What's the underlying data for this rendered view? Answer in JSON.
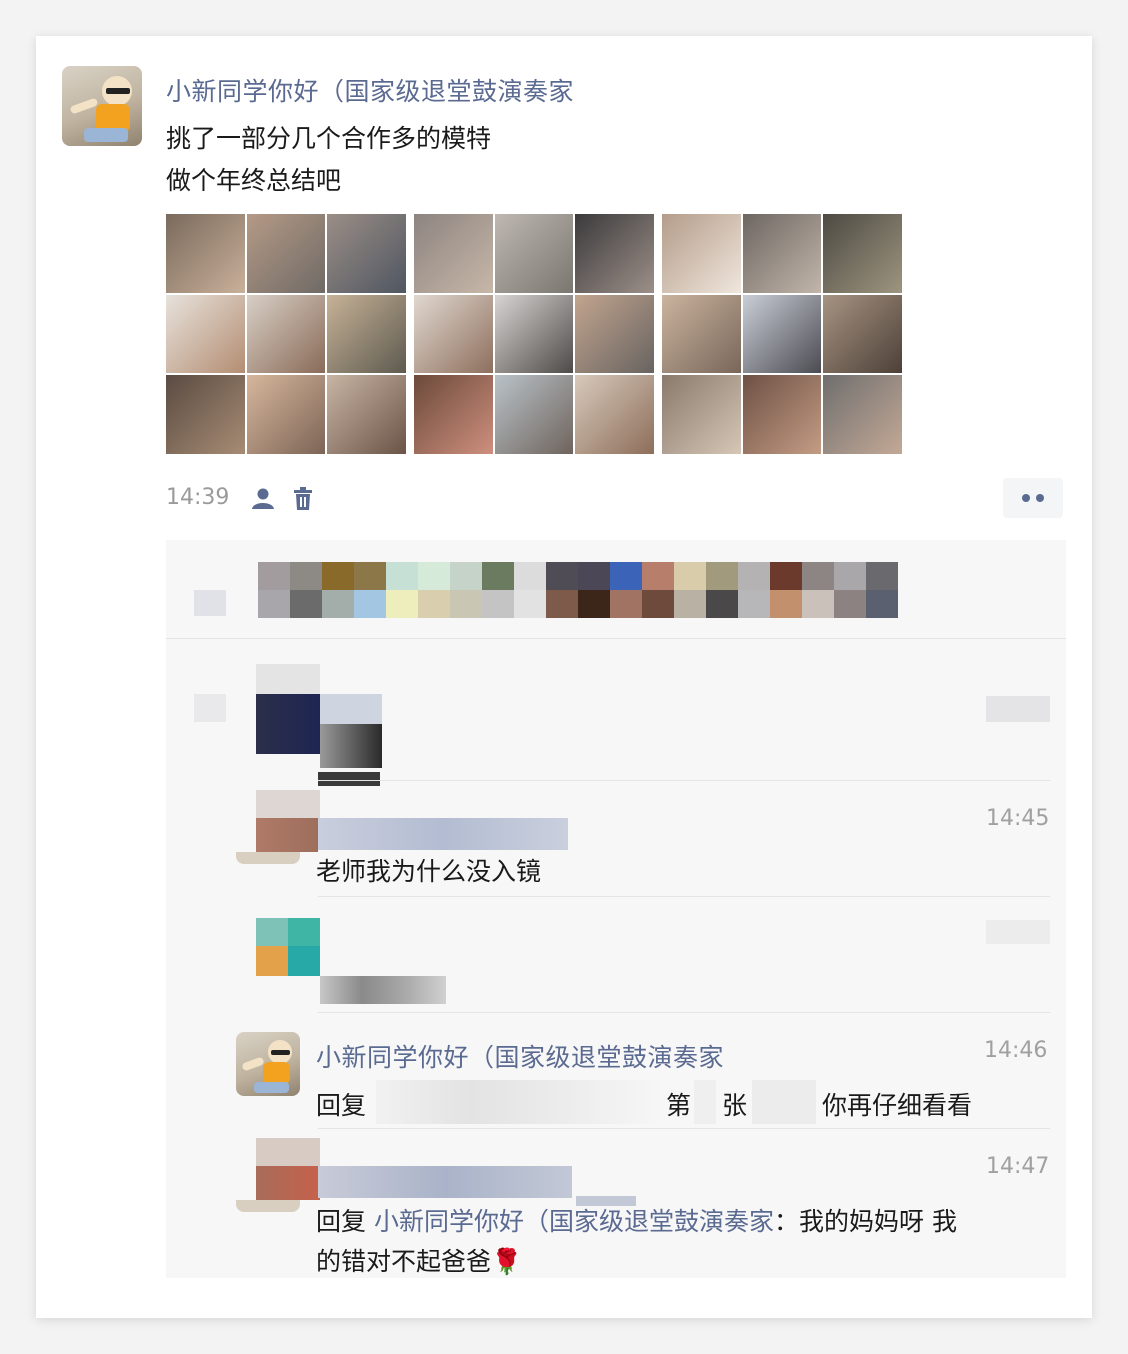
{
  "post": {
    "author": "小新同学你好（国家级退堂鼓演奏家",
    "lines": [
      "挑了一部分几个合作多的模特",
      "做个年终总结吧"
    ],
    "time": "14:39",
    "icons": [
      "friends-visibility-icon",
      "trash-icon",
      "more-icon"
    ]
  },
  "comments": [
    {
      "time": "14:45",
      "text": "老师我为什么没入镜"
    },
    {
      "author": "小新同学你好（国家级退堂鼓演奏家",
      "time": "14:46",
      "reply_prefix": "回复",
      "fragment1": "第",
      "fragment2": "张",
      "tail": "你再仔细看看"
    },
    {
      "time": "14:47",
      "reply_prefix": "回复",
      "reply_to": "小新同学你好（国家级退堂鼓演奏家",
      "sep": "：",
      "line1_rest": "我的妈妈呀 我",
      "line2": "的错对不起爸爸",
      "emoji": "🌹"
    }
  ]
}
